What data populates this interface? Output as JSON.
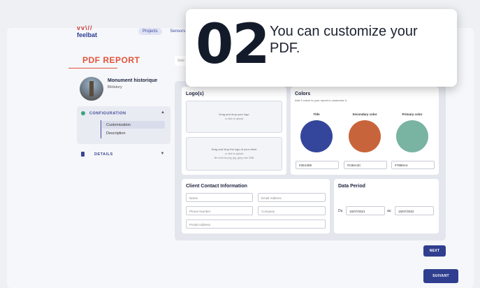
{
  "brand": {
    "mark": "vv\\//",
    "name": "feelbat"
  },
  "topnav": {
    "items": [
      "Projects",
      "Sensors"
    ]
  },
  "page": {
    "title": "PDF REPORT",
    "select_placeholder": "Sele"
  },
  "profile": {
    "name": "Monument historique",
    "subtitle": "BHistory"
  },
  "sidebar": {
    "configuration": {
      "label": "CONFIGURATION",
      "items": [
        "Customization",
        "Description"
      ]
    },
    "details": {
      "label": "DETAILS"
    }
  },
  "logos": {
    "title": "Logo(s)",
    "drop1": {
      "line1": "Drag and drop your logo",
      "line2": "or click to upload"
    },
    "drop2": {
      "line1": "Drag and drop the logo of your client",
      "line2": "or click to upload",
      "line3": "file must be png, jpg, jpeg, max 2MB"
    }
  },
  "colors": {
    "title": "Colors",
    "subtitle": "Add 3 colors to your report to customize it",
    "items": [
      {
        "label": "Title",
        "hex": "#2E4399",
        "color": "#34469b"
      },
      {
        "label": "Secondary color",
        "hex": "#C86A3C",
        "color": "#c8643b"
      },
      {
        "label": "Primary color",
        "hex": "#79B0A4",
        "color": "#79b3a2"
      }
    ]
  },
  "contact": {
    "title": "Client Contact Information",
    "fields": {
      "name": "Name",
      "email": "Email Address",
      "phone": "Phone Number",
      "company": "Company",
      "postal": "Postal Address"
    }
  },
  "period": {
    "title": "Data Period",
    "du_label": "Du",
    "du_value": "15/07/2021",
    "au_label": "au",
    "au_value": "15/07/2022"
  },
  "buttons": {
    "next": "NEXT",
    "suivant": "SUIVANT"
  },
  "tooltip": {
    "number": "02",
    "text": "You can customize your PDF."
  }
}
